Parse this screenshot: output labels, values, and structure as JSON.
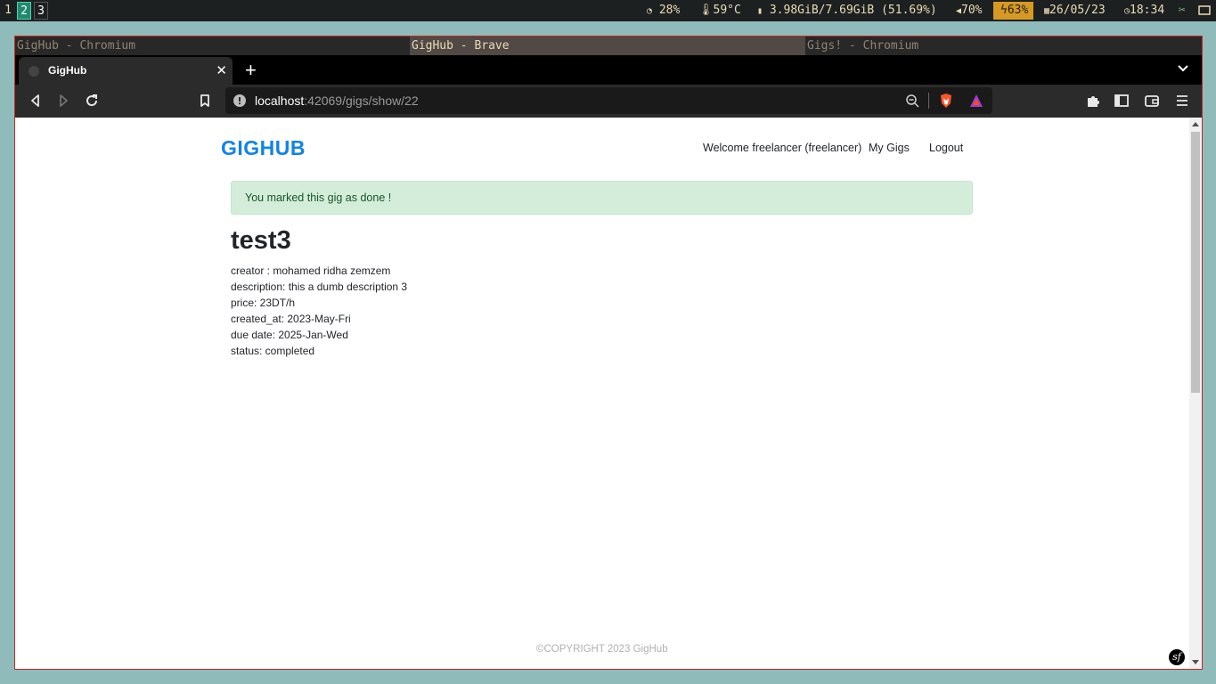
{
  "statusbar": {
    "workspaces": [
      "1",
      "2",
      "3"
    ],
    "cpu": "28%",
    "temp": "59°C",
    "memory": "3.98GiB/7.69GiB (51.69%)",
    "volume": "70%",
    "battery": "63%",
    "date": "26/05/23",
    "time": "18:34"
  },
  "window_titles": [
    "GigHub - Chromium",
    "GigHub - Brave",
    "Gigs! - Chromium"
  ],
  "browser": {
    "tab_title": "GigHub",
    "url_host": "localhost",
    "url_path": ":42069/gigs/show/22"
  },
  "page": {
    "brand": "GIGHUB",
    "nav": {
      "welcome": "Welcome freelancer (freelancer)",
      "my_gigs": "My Gigs",
      "logout": "Logout"
    },
    "alert": "You marked this gig as done !",
    "gig": {
      "title": "test3",
      "creator": "creator : mohamed ridha zemzem",
      "description": "description: this a dumb description 3",
      "price": "price: 23DT/h",
      "created_at": "created_at: 2023-May-Fri",
      "due_date": "due date: 2025-Jan-Wed",
      "status": "status: completed"
    },
    "footer": "©COPYRIGHT 2023 GigHub"
  },
  "colors": {
    "brand": "#1183e8",
    "alert_bg": "#d4edda",
    "alert_text": "#155724",
    "battery_bg": "#d79921",
    "active_workspace": "#1f8a70",
    "window_border": "#cc241d"
  }
}
